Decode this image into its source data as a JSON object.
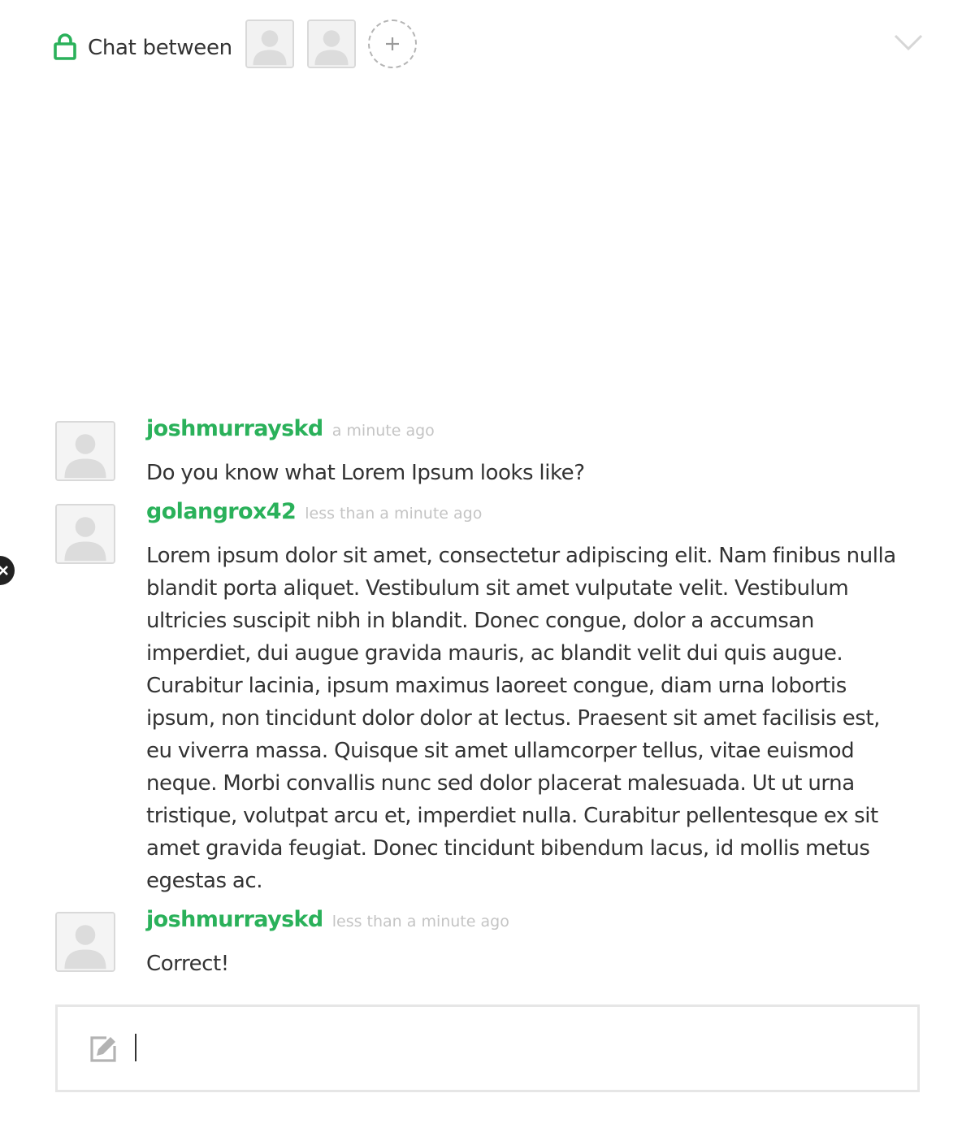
{
  "header": {
    "title": "Chat between",
    "participants": [
      {
        "icon": "user-avatar-icon"
      },
      {
        "icon": "user-avatar-icon"
      }
    ],
    "add_icon": "plus-icon",
    "collapse_icon": "chevron-down-icon"
  },
  "colors": {
    "accent": "#2ab15a",
    "timestamp": "#c4c4c4",
    "text": "#333333",
    "border": "#e6e6e6"
  },
  "messages": [
    {
      "author": "joshmurrayskd",
      "time": "a minute ago",
      "text": "Do you know what Lorem Ipsum looks like?"
    },
    {
      "author": "golangrox42",
      "time": "less than a minute ago",
      "text": "Lorem ipsum dolor sit amet, consectetur adipiscing elit. Nam finibus nulla blandit porta aliquet. Vestibulum sit amet vulputate velit. Vestibulum ultricies suscipit nibh in blandit. Donec congue, dolor a accumsan imperdiet, dui augue gravida mauris, ac blandit velit dui quis augue. Curabitur lacinia, ipsum maximus laoreet congue, diam urna lobortis ipsum, non tincidunt dolor dolor at lectus. Praesent sit amet facilisis est, eu viverra massa. Quisque sit amet ullamcorper tellus, vitae euismod neque. Morbi convallis nunc sed dolor placerat malesuada. Ut ut urna tristique, volutpat arcu et, imperdiet nulla. Curabitur pellentesque ex sit amet gravida feugiat. Donec tincidunt bibendum lacus, id mollis metus egestas ac."
    },
    {
      "author": "joshmurrayskd",
      "time": "less than a minute ago",
      "text": "Correct!"
    }
  ],
  "composer": {
    "value": "",
    "icon": "compose-icon"
  },
  "side_close_icon": "close-icon"
}
